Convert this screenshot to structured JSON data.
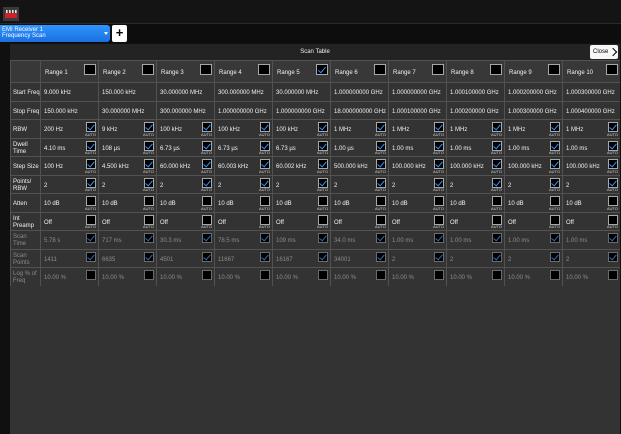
{
  "mode": {
    "line1": "EMI Receiver 1",
    "line2": "Frequency Scan"
  },
  "add_label": "+",
  "table": {
    "title": "Scan Table",
    "close_label": "Close",
    "ranges": [
      "Range 1",
      "Range 2",
      "Range 3",
      "Range 4",
      "Range 5",
      "Range 6",
      "Range 7",
      "Range 8",
      "Range 9",
      "Range 10"
    ],
    "range_enabled": [
      false,
      false,
      false,
      false,
      true,
      false,
      false,
      false,
      false,
      false
    ],
    "rows": [
      {
        "label": [
          "Start Freq"
        ],
        "dim": false,
        "auto": false,
        "values": [
          "9.000 kHz",
          "150.000 kHz",
          "30.000000 MHz",
          "300.000000 MHz",
          "30.000000 MHz",
          "1.000000000 GHz",
          "1.000000000 GHz",
          "1.000100000 GHz",
          "1.000200000 GHz",
          "1.000300000 GHz"
        ]
      },
      {
        "label": [
          "Stop Freq"
        ],
        "dim": false,
        "auto": false,
        "values": [
          "150.000 kHz",
          "30.000000 MHz",
          "300.000000 MHz",
          "1.000000000 GHz",
          "1.000000000 GHz",
          "18.000000000 GHz",
          "1.000100000 GHz",
          "1.000200000 GHz",
          "1.000300000 GHz",
          "1.000400000 GHz"
        ]
      },
      {
        "label": [
          "RBW"
        ],
        "dim": false,
        "auto": true,
        "values": [
          "200 Hz",
          "9 kHz",
          "100 kHz",
          "100 kHz",
          "100 kHz",
          "1 MHz",
          "1 MHz",
          "1 MHz",
          "1 MHz",
          "1 MHz"
        ],
        "checked": [
          true,
          true,
          true,
          true,
          true,
          true,
          true,
          true,
          true,
          true
        ]
      },
      {
        "label": [
          "Dwell",
          "Time"
        ],
        "dim": false,
        "auto": true,
        "values": [
          "4.10 ms",
          "108 µs",
          "6.73 µs",
          "6.73 µs",
          "6.73 µs",
          "1.00 µs",
          "1.00 ms",
          "1.00 ms",
          "1.00 ms",
          "1.00 ms"
        ],
        "checked": [
          true,
          true,
          true,
          true,
          true,
          true,
          true,
          true,
          true,
          true
        ]
      },
      {
        "label": [
          "Step Size"
        ],
        "dim": false,
        "auto": true,
        "values": [
          "100 Hz",
          "4.500 kHz",
          "60.000 kHz",
          "60.003 kHz",
          "60.002 kHz",
          "500.000 kHz",
          "100.000 kHz",
          "100.000 kHz",
          "100.000 kHz",
          "100.000 kHz"
        ],
        "checked": [
          true,
          true,
          true,
          true,
          true,
          true,
          true,
          true,
          true,
          true
        ]
      },
      {
        "label": [
          "Points/",
          "RBW"
        ],
        "dim": false,
        "auto": true,
        "values": [
          "2",
          "2",
          "2",
          "2",
          "2",
          "2",
          "2",
          "2",
          "2",
          "2"
        ],
        "checked": [
          true,
          true,
          true,
          true,
          true,
          true,
          true,
          true,
          true,
          true
        ]
      },
      {
        "label": [
          "Atten"
        ],
        "dim": false,
        "auto": true,
        "values": [
          "10 dB",
          "10 dB",
          "10 dB",
          "10 dB",
          "10 dB",
          "10 dB",
          "10 dB",
          "10 dB",
          "10 dB",
          "10 dB"
        ],
        "checked": [
          false,
          false,
          false,
          false,
          false,
          false,
          false,
          false,
          false,
          false
        ]
      },
      {
        "label": [
          "Int",
          "Preamp"
        ],
        "dim": false,
        "auto": true,
        "values": [
          "Off",
          "Off",
          "Off",
          "Off",
          "Off",
          "Off",
          "Off",
          "Off",
          "Off",
          "Off"
        ],
        "checked": [
          false,
          false,
          false,
          false,
          false,
          false,
          false,
          false,
          false,
          false
        ]
      },
      {
        "label": [
          "Scan",
          "Time"
        ],
        "dim": true,
        "auto": false,
        "values": [
          "5.78 s",
          "717 ms",
          "30.3 ms",
          "78.5 ms",
          "109 ms",
          "34.0 ms",
          "1.00 ms",
          "1.00 ms",
          "1.00 ms",
          "1.00 ms"
        ],
        "checked": [
          true,
          true,
          true,
          true,
          true,
          true,
          true,
          true,
          true,
          true
        ]
      },
      {
        "label": [
          "Scan",
          "Points"
        ],
        "dim": true,
        "auto": false,
        "values": [
          "1411",
          "6635",
          "4501",
          "11667",
          "16167",
          "34001",
          "2",
          "2",
          "2",
          "2"
        ],
        "checked": [
          true,
          true,
          true,
          true,
          true,
          true,
          true,
          true,
          true,
          true
        ]
      },
      {
        "label": [
          "Log % of",
          "Freq"
        ],
        "dim": true,
        "auto": false,
        "values": [
          "10.00 %",
          "10.00 %",
          "10.00 %",
          "10.00 %",
          "10.00 %",
          "10.00 %",
          "10.00 %",
          "10.00 %",
          "10.00 %",
          "10.00 %"
        ],
        "checked": [
          false,
          false,
          false,
          false,
          false,
          false,
          false,
          false,
          false,
          false
        ]
      }
    ],
    "auto_label": "AUTO"
  }
}
